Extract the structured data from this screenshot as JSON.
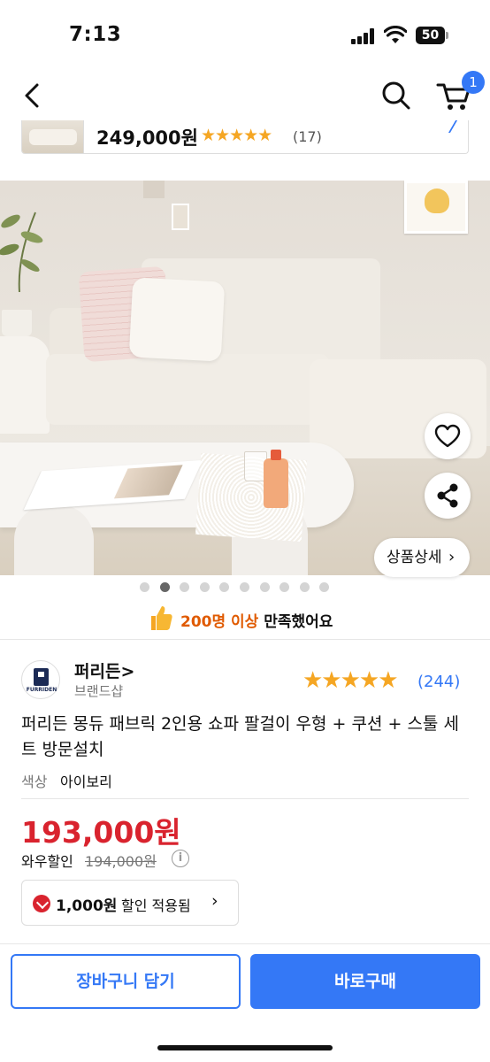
{
  "status_bar": {
    "time": "7:13",
    "battery": "50"
  },
  "nav": {
    "cart_count": "1"
  },
  "mini_product": {
    "price": "249,000원",
    "stars": "★★★★★",
    "review_count": "(17)"
  },
  "hero": {
    "detail_button": "상품상세",
    "detail_chevron": "›",
    "dot_count": 10,
    "active_dot": 1
  },
  "satisfaction": {
    "highlight": "200명 이상",
    "text": " 만족했어요"
  },
  "brand": {
    "logo_text": "FURRIDEN",
    "name": "퍼리든",
    "chevron": ">",
    "sub": "브랜드샵"
  },
  "rating": {
    "stars": "★★★★★",
    "count": "(244)"
  },
  "product": {
    "title": "퍼리든 몽듀 패브릭 2인용 쇼파 팔걸이 우형 + 쿠션 + 스툴 세트 방문설치",
    "option_label": "색상",
    "option_value": "아이보리"
  },
  "pricing": {
    "price": "193,000원",
    "original_label": "와우할인",
    "original_price": "194,000원",
    "info_icon": "i"
  },
  "coupon": {
    "amount": "1,000원",
    "text": "할인 적용됨",
    "chevron": "›"
  },
  "bottom": {
    "cart_button": "장바구니 담기",
    "buy_button": "바로구매"
  },
  "colors": {
    "accent": "#3478f6",
    "price_red": "#d9232e",
    "star": "#f5a623",
    "highlight_orange": "#e05a00"
  }
}
